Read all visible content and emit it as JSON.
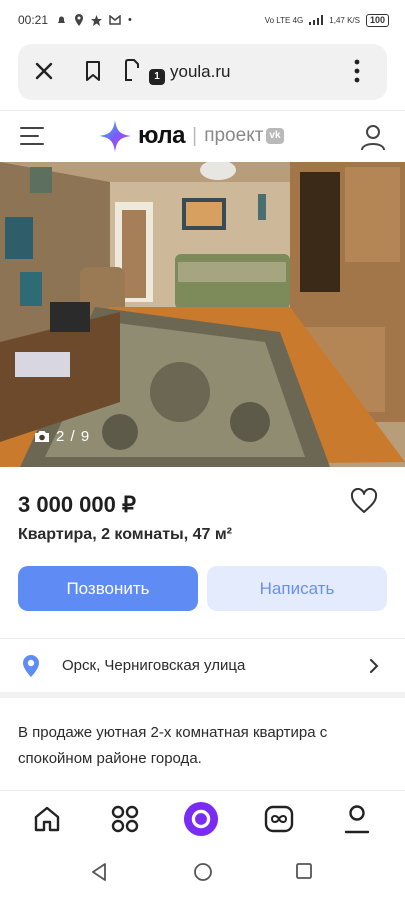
{
  "status_bar": {
    "time": "00:21",
    "network": "Vo LTE 4G",
    "speed": "1,47 K/S",
    "battery": "100"
  },
  "browser": {
    "url": "youla.ru",
    "tab_count": "1"
  },
  "site_header": {
    "brand": "юла",
    "project_text": "проект",
    "vk_badge": "vk"
  },
  "listing": {
    "photo_counter": "2 / 9",
    "price": "3 000 000 ₽",
    "title": "Квартира, 2 комнаты, 47 м²",
    "call_label": "Позвонить",
    "write_label": "Написать",
    "location": "Орск, Черниговская улица",
    "description": "В продаже уютная 2-х комнатная квартира с спокойном районе города."
  },
  "colors": {
    "accent_blue": "#5f8cf4",
    "secondary_button_bg": "#e3ebfd",
    "alice_purple": "#7a2cf5"
  },
  "tab_bar": {
    "items": [
      "home-icon",
      "catalog-icon",
      "alice-icon",
      "deals-icon",
      "profile-icon"
    ]
  }
}
